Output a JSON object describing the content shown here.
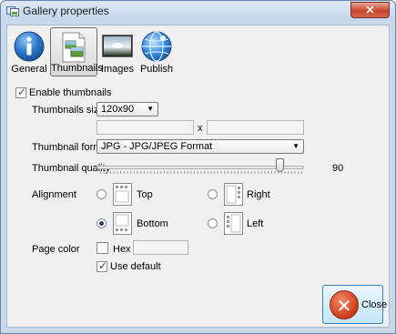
{
  "window": {
    "title": "Gallery properties",
    "close_glyph": "✕"
  },
  "toolbar": {
    "items": [
      {
        "label": "General",
        "icon": "info-icon",
        "active": false
      },
      {
        "label": "Thumbnails",
        "icon": "thumbnails-icon",
        "active": true
      },
      {
        "label": "Images",
        "icon": "image-icon",
        "active": false
      },
      {
        "label": "Publish",
        "icon": "globe-icon",
        "active": false
      }
    ]
  },
  "form": {
    "enable_thumbnails": {
      "label": "Enable thumbnails",
      "checked": true
    },
    "thumbnails_size": {
      "label": "Thumbnails size",
      "value": "120x90",
      "width": "",
      "height": "",
      "separator": "x"
    },
    "thumbnail_format": {
      "label": "Thumbnail format",
      "value": "JPG - JPG/JPEG Format"
    },
    "thumbnail_quality": {
      "label": "Thumbnail quality",
      "value": "90",
      "max": 100
    },
    "alignment": {
      "label": "Alignment",
      "options": [
        {
          "label": "Top",
          "selected": false
        },
        {
          "label": "Right",
          "selected": false
        },
        {
          "label": "Bottom",
          "selected": true
        },
        {
          "label": "Left",
          "selected": false
        }
      ]
    },
    "page_color": {
      "label": "Page color",
      "hex_label": "Hex",
      "hex_value": "",
      "swatch": "#ffffff"
    },
    "use_default": {
      "label": "Use default",
      "checked": true
    }
  },
  "buttons": {
    "close": {
      "label": "Close",
      "glyph": "✕"
    }
  },
  "colors": {
    "accent": "#3c7fb1",
    "close_red": "#d0401f"
  }
}
